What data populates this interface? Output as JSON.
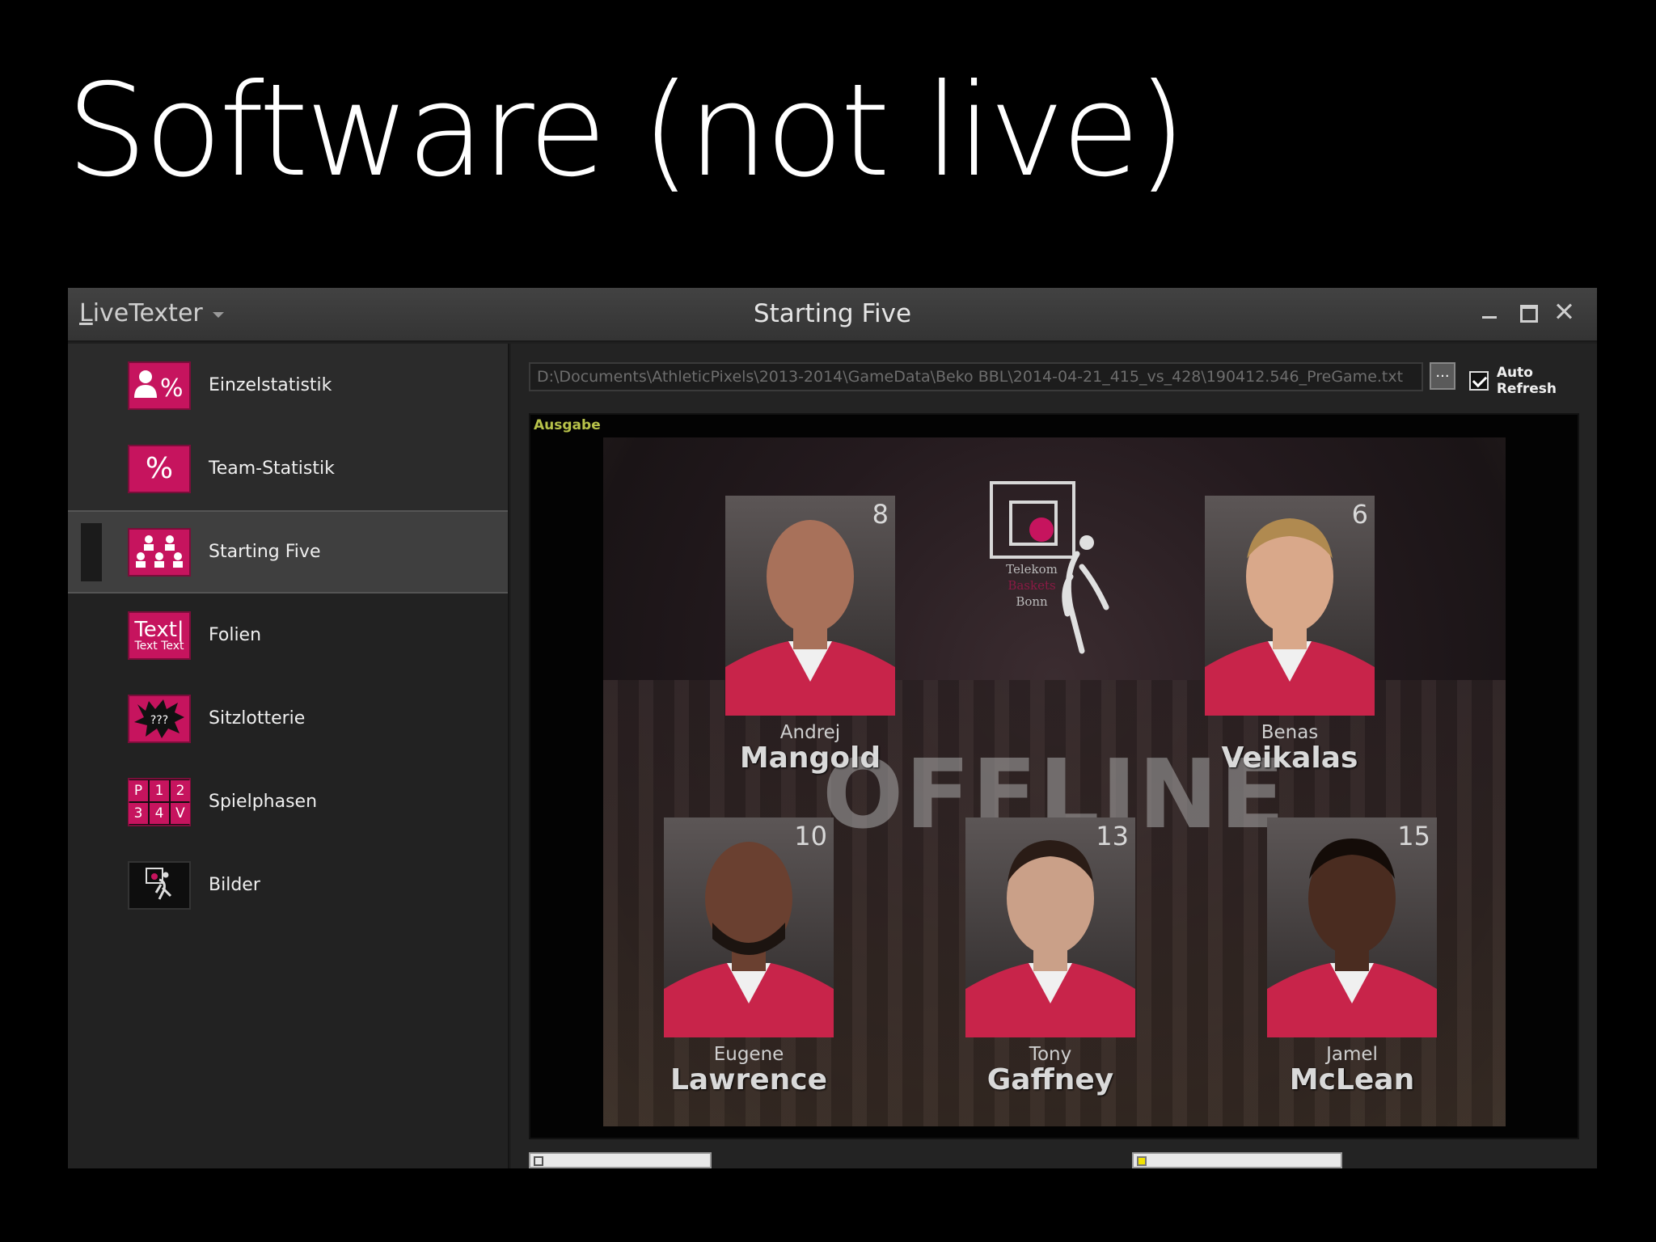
{
  "slide": {
    "title": "Software (not live)"
  },
  "window": {
    "app_name_initial": "L",
    "app_name_rest": "iveTexter",
    "title": "Starting Five"
  },
  "sidebar": {
    "items": [
      {
        "label": "Einzelstatistik",
        "icon": "person-percent-icon",
        "icon_text": "%"
      },
      {
        "label": "Team-Statistik",
        "icon": "percent-icon",
        "icon_text": "%"
      },
      {
        "label": "Starting Five",
        "icon": "starting-five-icon",
        "active": true
      },
      {
        "label": "Folien",
        "icon": "text-slide-icon",
        "icon_text": "Text|",
        "icon_subtext": "Text Text"
      },
      {
        "label": "Sitzlotterie",
        "icon": "seat-lottery-icon",
        "icon_text": "???"
      },
      {
        "label": "Spielphasen",
        "icon": "game-phases-icon",
        "icon_grid": [
          "P",
          "1",
          "2",
          "3",
          "4",
          "V"
        ]
      },
      {
        "label": "Bilder",
        "icon": "images-icon"
      }
    ]
  },
  "toolbar": {
    "file_path": "D:\\Documents\\AthleticPixels\\2013-2014\\GameData\\Beko BBL\\2014-04-21_415_vs_428\\190412.546_PreGame.txt",
    "browse_label": "...",
    "auto_refresh_label": "Auto Refresh",
    "auto_refresh_checked": true
  },
  "output": {
    "label": "Ausgabe",
    "status_overlay": "OFFLINE",
    "logo": {
      "line1": "Telekom",
      "line2": "Baskets",
      "line3": "Bonn"
    }
  },
  "players": [
    {
      "number": "8",
      "first_name": "Andrej",
      "last_name": "Mangold",
      "skin": "#a8715a"
    },
    {
      "number": "6",
      "first_name": "Benas",
      "last_name": "Veikalas",
      "skin": "#d9a88a"
    },
    {
      "number": "10",
      "first_name": "Eugene",
      "last_name": "Lawrence",
      "skin": "#6a4030"
    },
    {
      "number": "13",
      "first_name": "Tony",
      "last_name": "Gaffney",
      "skin": "#caa088"
    },
    {
      "number": "15",
      "first_name": "Jamel",
      "last_name": "McLean",
      "skin": "#4a2c20"
    }
  ],
  "colors": {
    "accent": "#c6145e",
    "jersey": "#c8244a",
    "output_label": "#b7c24a"
  }
}
